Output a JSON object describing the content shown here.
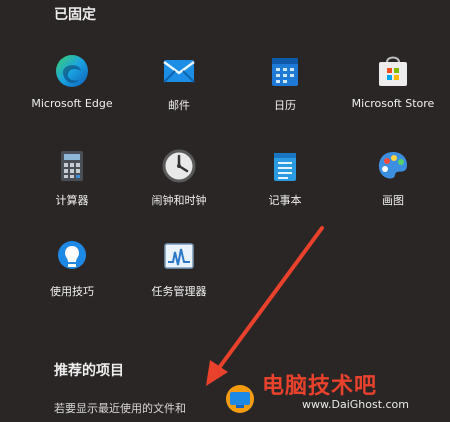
{
  "pinned": {
    "title": "已固定",
    "apps": [
      {
        "label": "Microsoft Edge",
        "icon": "edge-icon"
      },
      {
        "label": "邮件",
        "icon": "mail-icon"
      },
      {
        "label": "日历",
        "icon": "calendar-icon"
      },
      {
        "label": "Microsoft Store",
        "icon": "store-icon"
      },
      {
        "label": "计算器",
        "icon": "calculator-icon"
      },
      {
        "label": "闹钟和时钟",
        "icon": "clock-icon"
      },
      {
        "label": "记事本",
        "icon": "notepad-icon"
      },
      {
        "label": "画图",
        "icon": "paint-icon"
      },
      {
        "label": "使用技巧",
        "icon": "tips-icon"
      },
      {
        "label": "任务管理器",
        "icon": "task-manager-icon"
      }
    ]
  },
  "recommended": {
    "title": "推荐的项目",
    "hint": "若要显示最近使用的文件和"
  },
  "watermark": {
    "text": "电脑技术吧",
    "sub": "www.DaiGhost.com"
  },
  "colors": {
    "background": "#2b2626",
    "arrow": "#e8412c"
  }
}
